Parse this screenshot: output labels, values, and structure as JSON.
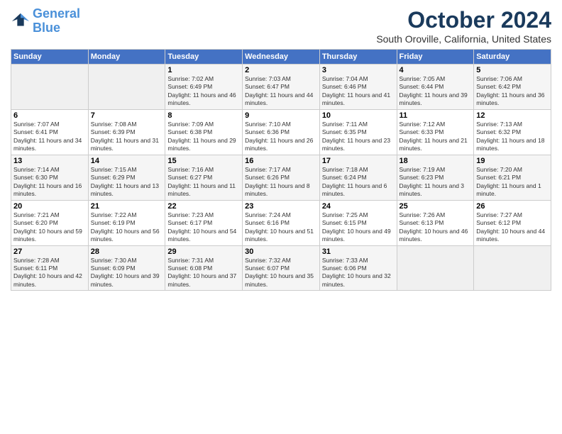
{
  "header": {
    "logo_line1": "General",
    "logo_line2": "Blue",
    "month": "October 2024",
    "location": "South Oroville, California, United States"
  },
  "weekdays": [
    "Sunday",
    "Monday",
    "Tuesday",
    "Wednesday",
    "Thursday",
    "Friday",
    "Saturday"
  ],
  "weeks": [
    [
      {
        "day": "",
        "info": ""
      },
      {
        "day": "",
        "info": ""
      },
      {
        "day": "1",
        "info": "Sunrise: 7:02 AM\nSunset: 6:49 PM\nDaylight: 11 hours and 46 minutes."
      },
      {
        "day": "2",
        "info": "Sunrise: 7:03 AM\nSunset: 6:47 PM\nDaylight: 11 hours and 44 minutes."
      },
      {
        "day": "3",
        "info": "Sunrise: 7:04 AM\nSunset: 6:46 PM\nDaylight: 11 hours and 41 minutes."
      },
      {
        "day": "4",
        "info": "Sunrise: 7:05 AM\nSunset: 6:44 PM\nDaylight: 11 hours and 39 minutes."
      },
      {
        "day": "5",
        "info": "Sunrise: 7:06 AM\nSunset: 6:42 PM\nDaylight: 11 hours and 36 minutes."
      }
    ],
    [
      {
        "day": "6",
        "info": "Sunrise: 7:07 AM\nSunset: 6:41 PM\nDaylight: 11 hours and 34 minutes."
      },
      {
        "day": "7",
        "info": "Sunrise: 7:08 AM\nSunset: 6:39 PM\nDaylight: 11 hours and 31 minutes."
      },
      {
        "day": "8",
        "info": "Sunrise: 7:09 AM\nSunset: 6:38 PM\nDaylight: 11 hours and 29 minutes."
      },
      {
        "day": "9",
        "info": "Sunrise: 7:10 AM\nSunset: 6:36 PM\nDaylight: 11 hours and 26 minutes."
      },
      {
        "day": "10",
        "info": "Sunrise: 7:11 AM\nSunset: 6:35 PM\nDaylight: 11 hours and 23 minutes."
      },
      {
        "day": "11",
        "info": "Sunrise: 7:12 AM\nSunset: 6:33 PM\nDaylight: 11 hours and 21 minutes."
      },
      {
        "day": "12",
        "info": "Sunrise: 7:13 AM\nSunset: 6:32 PM\nDaylight: 11 hours and 18 minutes."
      }
    ],
    [
      {
        "day": "13",
        "info": "Sunrise: 7:14 AM\nSunset: 6:30 PM\nDaylight: 11 hours and 16 minutes."
      },
      {
        "day": "14",
        "info": "Sunrise: 7:15 AM\nSunset: 6:29 PM\nDaylight: 11 hours and 13 minutes."
      },
      {
        "day": "15",
        "info": "Sunrise: 7:16 AM\nSunset: 6:27 PM\nDaylight: 11 hours and 11 minutes."
      },
      {
        "day": "16",
        "info": "Sunrise: 7:17 AM\nSunset: 6:26 PM\nDaylight: 11 hours and 8 minutes."
      },
      {
        "day": "17",
        "info": "Sunrise: 7:18 AM\nSunset: 6:24 PM\nDaylight: 11 hours and 6 minutes."
      },
      {
        "day": "18",
        "info": "Sunrise: 7:19 AM\nSunset: 6:23 PM\nDaylight: 11 hours and 3 minutes."
      },
      {
        "day": "19",
        "info": "Sunrise: 7:20 AM\nSunset: 6:21 PM\nDaylight: 11 hours and 1 minute."
      }
    ],
    [
      {
        "day": "20",
        "info": "Sunrise: 7:21 AM\nSunset: 6:20 PM\nDaylight: 10 hours and 59 minutes."
      },
      {
        "day": "21",
        "info": "Sunrise: 7:22 AM\nSunset: 6:19 PM\nDaylight: 10 hours and 56 minutes."
      },
      {
        "day": "22",
        "info": "Sunrise: 7:23 AM\nSunset: 6:17 PM\nDaylight: 10 hours and 54 minutes."
      },
      {
        "day": "23",
        "info": "Sunrise: 7:24 AM\nSunset: 6:16 PM\nDaylight: 10 hours and 51 minutes."
      },
      {
        "day": "24",
        "info": "Sunrise: 7:25 AM\nSunset: 6:15 PM\nDaylight: 10 hours and 49 minutes."
      },
      {
        "day": "25",
        "info": "Sunrise: 7:26 AM\nSunset: 6:13 PM\nDaylight: 10 hours and 46 minutes."
      },
      {
        "day": "26",
        "info": "Sunrise: 7:27 AM\nSunset: 6:12 PM\nDaylight: 10 hours and 44 minutes."
      }
    ],
    [
      {
        "day": "27",
        "info": "Sunrise: 7:28 AM\nSunset: 6:11 PM\nDaylight: 10 hours and 42 minutes."
      },
      {
        "day": "28",
        "info": "Sunrise: 7:30 AM\nSunset: 6:09 PM\nDaylight: 10 hours and 39 minutes."
      },
      {
        "day": "29",
        "info": "Sunrise: 7:31 AM\nSunset: 6:08 PM\nDaylight: 10 hours and 37 minutes."
      },
      {
        "day": "30",
        "info": "Sunrise: 7:32 AM\nSunset: 6:07 PM\nDaylight: 10 hours and 35 minutes."
      },
      {
        "day": "31",
        "info": "Sunrise: 7:33 AM\nSunset: 6:06 PM\nDaylight: 10 hours and 32 minutes."
      },
      {
        "day": "",
        "info": ""
      },
      {
        "day": "",
        "info": ""
      }
    ]
  ]
}
